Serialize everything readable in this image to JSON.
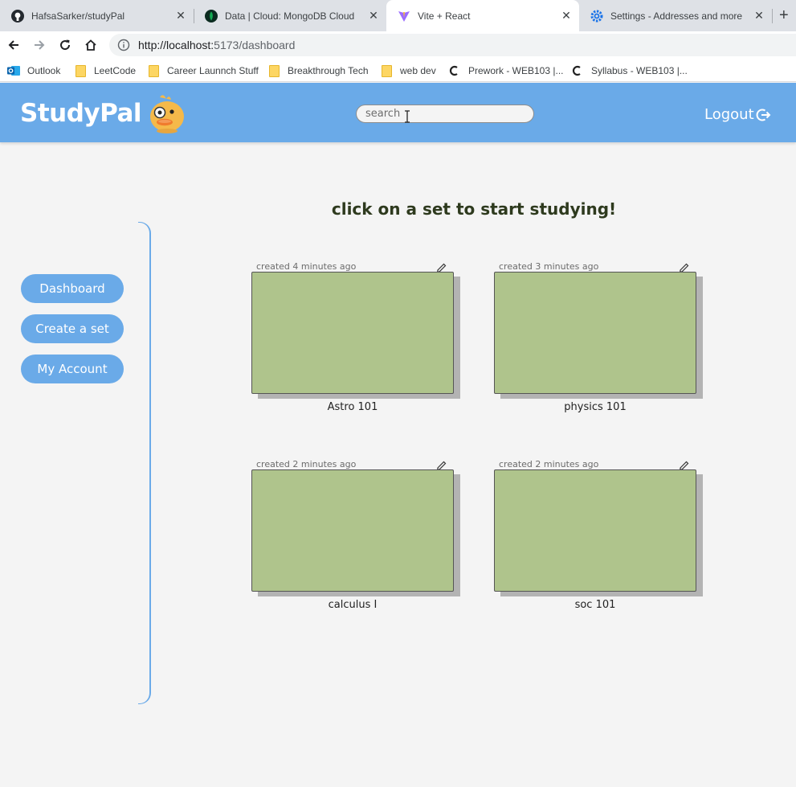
{
  "browser": {
    "tabs": [
      {
        "title": "HafsaSarker/studyPal",
        "icon": "github-icon"
      },
      {
        "title": "Data | Cloud: MongoDB Cloud",
        "icon": "mongodb-leaf-icon"
      },
      {
        "title": "Vite + React",
        "icon": "vite-icon",
        "active": true
      },
      {
        "title": "Settings - Addresses and more",
        "icon": "settings-gear-icon"
      }
    ],
    "url_host": "http://localhost:",
    "url_path": "5173/dashboard",
    "bookmarks": [
      {
        "label": "Outlook",
        "icon": "outlook-icon"
      },
      {
        "label": "LeetCode",
        "icon": "folder-icon"
      },
      {
        "label": "Career Launnch Stuff",
        "icon": "folder-icon"
      },
      {
        "label": "Breakthrough Tech",
        "icon": "folder-icon"
      },
      {
        "label": "web dev",
        "icon": "folder-icon"
      },
      {
        "label": "Prework - WEB103 |...",
        "icon": "codepath-icon"
      },
      {
        "label": "Syllabus - WEB103 |...",
        "icon": "codepath-icon"
      }
    ]
  },
  "header": {
    "brand": "StudyPal",
    "search_placeholder": "search",
    "logout_label": "Logout"
  },
  "sidebar": {
    "items": [
      {
        "label": "Dashboard"
      },
      {
        "label": "Create a set"
      },
      {
        "label": "My Account"
      }
    ]
  },
  "main": {
    "headline": "click on a set to start studying!",
    "sets": [
      {
        "created": "created 4 minutes ago",
        "name": "Astro 101"
      },
      {
        "created": "created 3 minutes ago",
        "name": "physics 101"
      },
      {
        "created": "created 2 minutes ago",
        "name": "calculus I"
      },
      {
        "created": "created 2 minutes ago",
        "name": "soc 101"
      }
    ]
  },
  "colors": {
    "header": "#6aaae8",
    "card": "#afc48c",
    "background": "#f4f4f4"
  }
}
